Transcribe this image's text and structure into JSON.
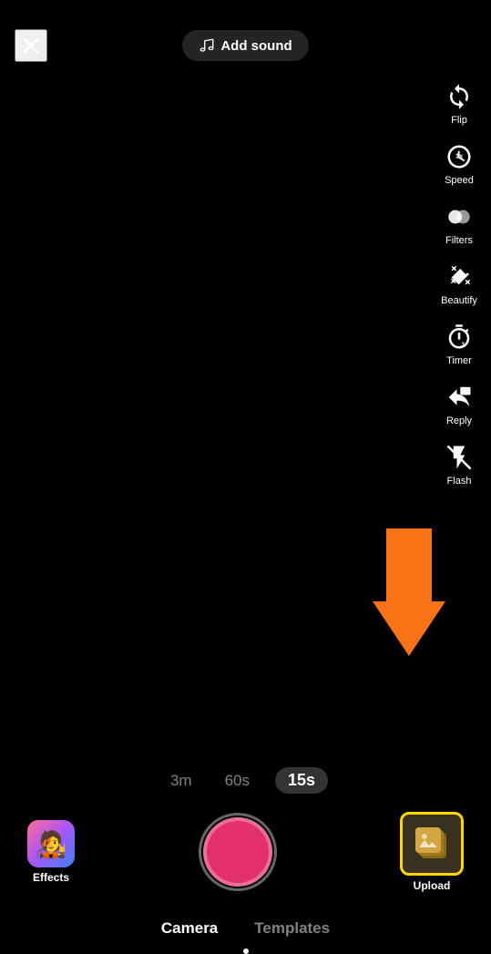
{
  "header": {
    "close_label": "×",
    "add_sound_label": "Add sound",
    "close_aria": "Close"
  },
  "sidebar": {
    "items": [
      {
        "id": "flip",
        "label": "Flip",
        "icon": "flip-icon"
      },
      {
        "id": "speed",
        "label": "Speed",
        "icon": "speed-icon"
      },
      {
        "id": "filters",
        "label": "Filters",
        "icon": "filters-icon"
      },
      {
        "id": "beautify",
        "label": "Beautify",
        "icon": "beautify-icon"
      },
      {
        "id": "timer",
        "label": "Timer",
        "icon": "timer-icon"
      },
      {
        "id": "reply",
        "label": "Reply",
        "icon": "reply-icon"
      },
      {
        "id": "flash",
        "label": "Flash",
        "icon": "flash-icon"
      }
    ]
  },
  "duration": {
    "options": [
      {
        "value": "3m",
        "label": "3m",
        "active": false
      },
      {
        "value": "60s",
        "label": "60s",
        "active": false
      },
      {
        "value": "15s",
        "label": "15s",
        "active": true
      }
    ]
  },
  "controls": {
    "effects_label": "Effects",
    "upload_label": "Upload",
    "record_aria": "Record"
  },
  "nav": {
    "tabs": [
      {
        "id": "camera",
        "label": "Camera",
        "active": true
      },
      {
        "id": "templates",
        "label": "Templates",
        "active": false
      }
    ]
  },
  "arrow": {
    "color": "#f97316"
  },
  "colors": {
    "record_button": "#e1306c",
    "upload_border": "#ffd700",
    "active_tab": "#ffffff",
    "inactive_tab": "rgba(255,255,255,0.5)"
  }
}
